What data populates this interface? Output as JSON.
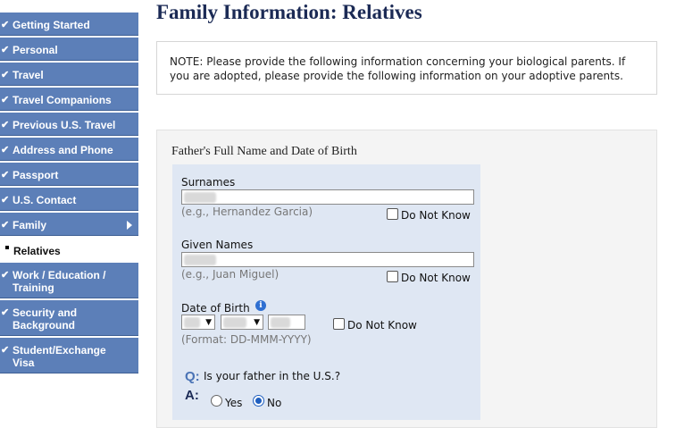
{
  "sidebar": {
    "items": [
      {
        "label": "Getting Started",
        "checked": true
      },
      {
        "label": "Personal",
        "checked": true
      },
      {
        "label": "Travel",
        "checked": true
      },
      {
        "label": "Travel Companions",
        "checked": true
      },
      {
        "label": "Previous U.S. Travel",
        "checked": true
      },
      {
        "label": "Address and Phone",
        "checked": true
      },
      {
        "label": "Passport",
        "checked": true
      },
      {
        "label": "U.S. Contact",
        "checked": true
      },
      {
        "label": "Family",
        "checked": true,
        "expanded": true
      },
      {
        "label": "Relatives",
        "sub": true
      },
      {
        "label": "Work / Education / Training",
        "checked": true
      },
      {
        "label": "Security and Background",
        "checked": true
      },
      {
        "label": "Student/Exchange Visa",
        "checked": true
      }
    ],
    "check_glyph": "✔"
  },
  "page": {
    "title": "Family Information: Relatives",
    "note": "NOTE: Please provide the following information concerning your biological parents. If you are adopted, please provide the following information on your adoptive parents."
  },
  "father": {
    "section_title": "Father's Full Name and Date of Birth",
    "surnames_label": "Surnames",
    "surnames_hint": "(e.g., Hernandez Garcia)",
    "given_label": "Given Names",
    "given_hint": "(e.g., Juan Miguel)",
    "do_not_know": "Do Not Know",
    "dob_label": "Date of Birth",
    "dob_hint": "(Format: DD-MMM-YYYY)",
    "question_marker": "Q:",
    "answer_marker": "A:",
    "question": "Is your father in the U.S.?",
    "yes_label": "Yes",
    "no_label": "No",
    "selected": "No"
  },
  "colors": {
    "nav": "#5c7fb8",
    "title": "#1b2a55",
    "panel": "#dfe7f3"
  }
}
